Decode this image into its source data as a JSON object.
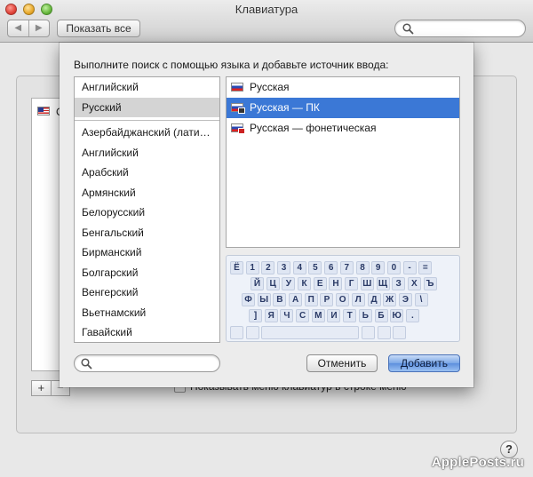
{
  "window": {
    "title": "Клавиатура"
  },
  "toolbar": {
    "back_glyph": "◀",
    "forward_glyph": "▶",
    "show_all_label": "Показать все",
    "search_placeholder": ""
  },
  "background": {
    "list_first_item_letter": "C",
    "plus_label": "+",
    "minus_label": "−",
    "show_menu_checkbox_label": "Показывать меню клавиатур в строке меню",
    "show_menu_checked": false,
    "help_label": "?"
  },
  "sheet": {
    "prompt": "Выполните поиск с помощью языка и добавьте источник ввода:",
    "languages_top": [
      "Английский",
      "Русский"
    ],
    "selected_language": "Русский",
    "languages_all": [
      "Азербайджанский (лати…",
      "Английский",
      "Арабский",
      "Армянский",
      "Белорусский",
      "Бенгальский",
      "Бирманский",
      "Болгарский",
      "Венгерский",
      "Вьетнамский",
      "Гавайский"
    ],
    "sources": [
      {
        "label": "Русская",
        "flag": "ru-flag-icon",
        "selected": false
      },
      {
        "label": "Русская — ПК",
        "flag": "ru-pc-flag-icon",
        "selected": true
      },
      {
        "label": "Русская — фонетическая",
        "flag": "ru-phonetic-flag-icon",
        "selected": false
      }
    ],
    "keyboard_rows": [
      [
        "Ё",
        "1",
        "2",
        "3",
        "4",
        "5",
        "6",
        "7",
        "8",
        "9",
        "0",
        "-",
        "="
      ],
      [
        "Й",
        "Ц",
        "У",
        "К",
        "Е",
        "Н",
        "Г",
        "Ш",
        "Щ",
        "З",
        "Х",
        "Ъ"
      ],
      [
        "Ф",
        "Ы",
        "В",
        "А",
        "П",
        "Р",
        "О",
        "Л",
        "Д",
        "Ж",
        "Э",
        "\\"
      ],
      [
        "]",
        "Я",
        "Ч",
        "С",
        "М",
        "И",
        "Т",
        "Ь",
        "Б",
        "Ю",
        "."
      ]
    ],
    "search_placeholder": "",
    "cancel_label": "Отменить",
    "add_label": "Добавить"
  },
  "watermark": "ApplePosts.ru"
}
